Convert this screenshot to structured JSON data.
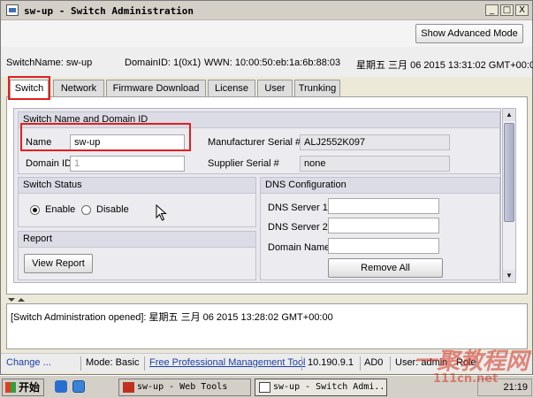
{
  "window": {
    "title": "sw-up - Switch Administration",
    "controls": {
      "minimize": "_",
      "maximize": "□",
      "close": "X"
    }
  },
  "topbar": {
    "show_advanced_label": "Show Advanced Mode"
  },
  "info": {
    "switch_name": "SwitchName: sw-up",
    "domain_id": "DomainID: 1(0x1)",
    "wwn": "WWN: 10:00:50:eb:1a:6b:88:03",
    "datetime": "星期五 三月 06 2015 13:31:02 GMT+00:00"
  },
  "tabs": [
    {
      "label": "Switch",
      "active": true
    },
    {
      "label": "Network"
    },
    {
      "label": "Firmware Download"
    },
    {
      "label": "License"
    },
    {
      "label": "User"
    },
    {
      "label": "Trunking"
    }
  ],
  "switch_name_section": {
    "header": "Switch Name and Domain ID",
    "name_label": "Name",
    "name_value": "sw-up",
    "domain_label": "Domain ID",
    "domain_value": "1",
    "mfr_serial_label": "Manufacturer Serial #",
    "mfr_serial_value": "ALJ2552K097",
    "supplier_serial_label": "Supplier Serial #",
    "supplier_serial_value": "none"
  },
  "switch_status": {
    "header": "Switch Status",
    "enable_label": "Enable",
    "disable_label": "Disable",
    "selected": "Enable"
  },
  "report": {
    "header": "Report",
    "view_report_label": "View Report"
  },
  "dns": {
    "header": "DNS Configuration",
    "server1_label": "DNS Server 1",
    "server1_value": "",
    "server2_label": "DNS Server 2",
    "server2_value": "",
    "domain_name_label": "Domain Name",
    "domain_name_value": "",
    "remove_all_label": "Remove All"
  },
  "log": {
    "line1": "[Switch Administration opened]: 星期五 三月 06 2015 13:28:02 GMT+00:00"
  },
  "status_bar": {
    "change": "Change ...",
    "mode": "Mode: Basic",
    "link": "Free Professional Management Tool",
    "ip": "10.190.9.1",
    "ad": "AD0",
    "user": "User: admin",
    "role": "Role"
  },
  "taskbar": {
    "start_label": "开始",
    "task1": "sw-up - Web Tools",
    "task2": "sw-up - Switch Admi...",
    "clock": "21:19"
  },
  "watermark": {
    "text": "一聚教程网",
    "sub": "111cn.net"
  }
}
